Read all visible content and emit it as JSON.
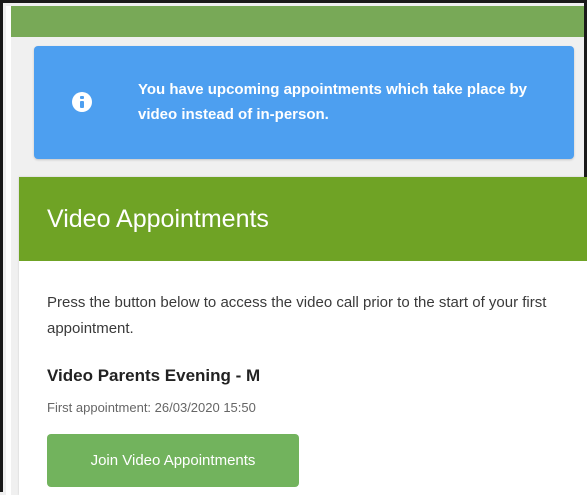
{
  "alert": {
    "icon": "info-icon",
    "message": "You have upcoming appointments which take place by video instead of in-person."
  },
  "panel": {
    "title": "Video Appointments",
    "description": "Press the button below to access the video call prior to the start of your first appointment.",
    "event_name": "Video Parents Evening - M",
    "first_appointment": "First appointment: 26/03/2020 15:50",
    "join_button_label": "Join Video Appointments"
  },
  "colors": {
    "top_bar": "#78a957",
    "alert_background": "#4d9ff0",
    "panel_header": "#6fa325",
    "join_button": "#72b35d"
  }
}
